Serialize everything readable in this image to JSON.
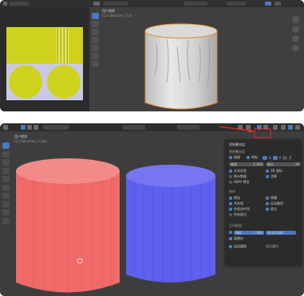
{
  "top": {
    "viewport_title": "用户透视",
    "viewport_subtitle": "(1) Collection | Cyl"
  },
  "bottom": {
    "viewport_title": "用户透视",
    "viewport_subtitle": "(1) Collection | Cube",
    "overlay_panel": {
      "title": "视图叠加层",
      "section_guides": "视图叠加层",
      "grid_label": "网格",
      "floor_label": "地板",
      "x_label": "X",
      "y_label": "Y",
      "z_label": "Z",
      "scale_label": "缩放",
      "scale_value": "1.000",
      "subdiv_label": "细分",
      "subdiv_value": "10",
      "text_info": "文本信息",
      "statistics": "统计数据",
      "hdri_preview": "HDRI 预览",
      "three_d_cursor": "3D 游标",
      "annotations": "注释",
      "objects_section": "物体",
      "extras": "附加",
      "relationship_lines": "关系线",
      "outline_selected": "外框选中项",
      "all_origins": "所有原点",
      "bones": "骨骼",
      "motion_paths": "运动路径",
      "origins": "原点",
      "geometry_section": "几何数据",
      "wireframe_label": "线框",
      "wireframe_value": "1.000",
      "fade_geometry": "淡化几何体",
      "face_orientation": "面朝向",
      "face_orientation_checked": true,
      "motion_tracking": "运动跟踪",
      "camera_reconstruction": "相机重构"
    }
  },
  "colors": {
    "annotation_red": "#e0302b",
    "cylinder_red": "#f06a6a",
    "cylinder_blue": "#5f5ff0",
    "accent_blue": "#4a78c4"
  }
}
